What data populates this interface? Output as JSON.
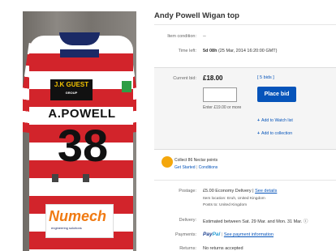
{
  "listing": {
    "title": "Andy Powell Wigan top",
    "condition_label": "Item condition:",
    "condition_value": "--",
    "time_left_label": "Time left:",
    "time_left_value": "5d 08h",
    "time_left_detail": "(25 Mar, 2014  16:20:00 GMT)"
  },
  "bid": {
    "label": "Current bid:",
    "price": "£18.00",
    "bids_link": "[ 5 bids ]",
    "input_placeholder": "",
    "enter_hint": "Enter £19.00 or more",
    "place_bid_label": "Place bid",
    "watch_label": "Add to Watch list",
    "collection_label": "Add to collection"
  },
  "nectar": {
    "points_text": "Collect 86 Nectar points",
    "get_started": "Get Started",
    "separator": " | ",
    "conditions": "Conditions"
  },
  "shipping": {
    "postage_label": "Postage:",
    "postage_value": "£5.00  Economy Delivery |",
    "postage_link": "See details",
    "item_location": "Item location: Eruh, United Kingdom",
    "posts_to": "Posts to: United Kingdom",
    "delivery_label": "Delivery:",
    "delivery_value": "Estimated between Sat. 29 Mar. and Mon. 31 Mar. ⓘ",
    "payments_label": "Payments:",
    "paypal_pay": "Pay",
    "paypal_pal": "Pal",
    "payments_link": "See payment information",
    "returns_label": "Returns:",
    "returns_value": "No returns accepted"
  },
  "photo": {
    "jersey_sponsor": "J.K GUEST",
    "jersey_sponsor_sub": "GROUP",
    "player_name": "A.POWELL",
    "player_number": "38",
    "bottom_sponsor": "Numech",
    "bottom_sponsor_tag": "engineering solutions"
  }
}
